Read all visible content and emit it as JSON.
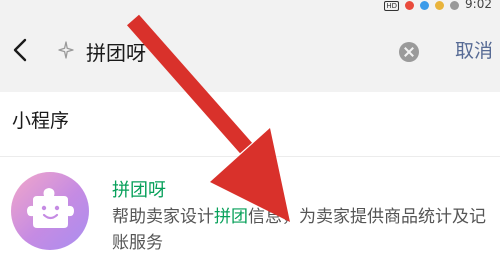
{
  "status_bar": {
    "hd_badge": "HD",
    "time": "9:02"
  },
  "search": {
    "query": "拼团呀",
    "cancel_label": "取消",
    "back_icon": "chevron-left-icon",
    "prefix_icon": "sparkle-icon",
    "clear_icon": "clear-icon"
  },
  "results": {
    "section_title": "小程序",
    "items": [
      {
        "name": "拼团呀",
        "desc_before": "帮助卖家设计",
        "desc_highlight": "拼团",
        "desc_after": "信息，为卖家提供商品统计及记账服务",
        "logo_icon": "puzzle-smile-icon"
      }
    ]
  },
  "colors": {
    "accent_green": "#07a05a",
    "link_blue": "#576b95",
    "arrow_red": "#d9312b"
  }
}
